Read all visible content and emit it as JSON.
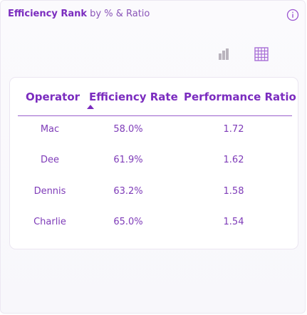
{
  "widget": {
    "title_strong": "Efficiency Rank",
    "title_rest": " by % & Ratio"
  },
  "table": {
    "headers": [
      "Operator",
      "Efficiency Rate",
      "Performance Ratio"
    ],
    "sorted_column": "Efficiency Rate",
    "sort_direction": "ascending",
    "rows": [
      {
        "operator": "Mac",
        "rate": "58.0%",
        "ratio": "1.72"
      },
      {
        "operator": "Dee",
        "rate": "61.9%",
        "ratio": "1.62"
      },
      {
        "operator": "Dennis",
        "rate": "63.2%",
        "ratio": "1.58"
      },
      {
        "operator": "Charlie",
        "rate": "65.0%",
        "ratio": "1.54"
      }
    ]
  },
  "icons": {
    "info": "info-icon",
    "bar_view": "bar-chart-icon",
    "table_view": "grid-icon"
  },
  "colors": {
    "accent": "#7b2cbf",
    "text": "#7e3bb8",
    "icon_muted": "#b9b3bd",
    "icon_active": "#a86fd6"
  }
}
